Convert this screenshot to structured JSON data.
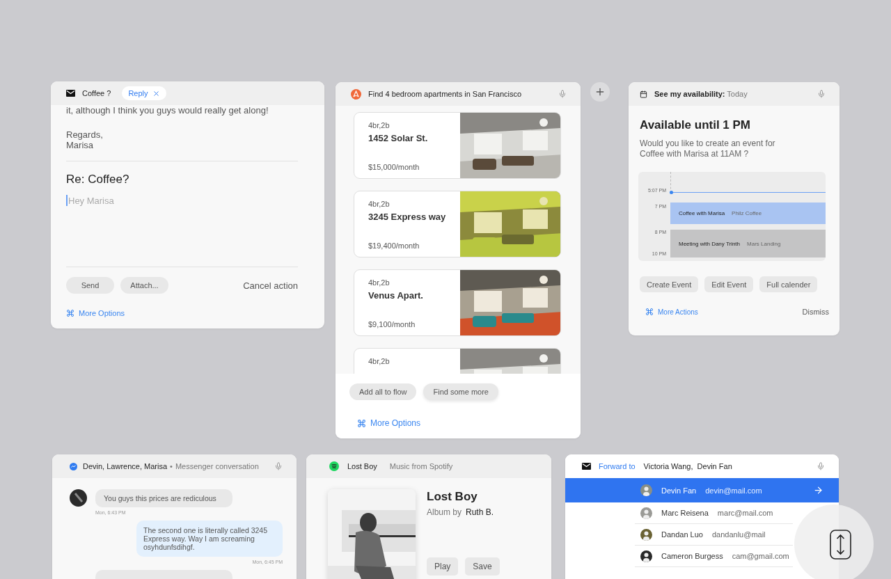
{
  "email_card": {
    "subject": "Coffee ?",
    "chip": {
      "label": "Reply"
    },
    "body_lines": [
      "it, although I think you guys would really get along!"
    ],
    "signature": [
      "Regards,",
      "Marisa"
    ],
    "reply_title": "Re: Coffee?",
    "reply_field": {
      "placeholder": "Hey Marisa"
    },
    "buttons": [
      "Send",
      "Attach..."
    ],
    "cancel": "Cancel action",
    "more": "More Options"
  },
  "apartments_card": {
    "query": "Find 4 bedroom apartments in San Francisco",
    "listings": [
      {
        "rooms": "4br,2b",
        "title": "1452 Solar St.",
        "price": "$15,000/month"
      },
      {
        "rooms": "4br,2b",
        "title": "3245 Express way",
        "price": "$19,400/month"
      },
      {
        "rooms": "4br,2b",
        "title": "Venus Apart.",
        "price": "$9,100/month"
      },
      {
        "rooms": "4br,2b"
      }
    ],
    "buttons": [
      "Add all to flow",
      "Find some more"
    ],
    "more": "More Options"
  },
  "calendar_card": {
    "query": "**See my availability:** Today",
    "heading": "Available until 1 PM",
    "question": "Would you like to create an event for Coffee with Marisa at 11AM ?",
    "schedule": {
      "now": "5:07 PM",
      "events": [
        {
          "time": "7 PM",
          "title": "Coffee with Marisa",
          "place": "Philz Coffee",
          "color": "#a9c4f2"
        },
        {
          "time": "8 PM",
          "end": "10 PM",
          "title": "Meeting with Dany Trinth",
          "place": "Mars Landing",
          "color": "#c4c4c5"
        }
      ]
    },
    "buttons": [
      "Create Event",
      "Edit Event",
      "Full calender"
    ],
    "more": "More Actions",
    "dismiss": "Dismiss"
  },
  "messenger_card": {
    "participants": "Devin, Lawrence, Marisa",
    "separator": "•",
    "source": "Messenger conversation",
    "messages": [
      {
        "mine": false,
        "text": "You guys this prices are rediculous",
        "time": "Mon, 6:43 PM"
      },
      {
        "mine": true,
        "text": "The second one is literally called 3245 Express way. Way I am screaming osyhdunfsdihgf.",
        "time": "Mon, 6:45 PM"
      },
      {
        "mine": false
      }
    ]
  },
  "music_card": {
    "track": "Lost Boy",
    "source": "Music from Spotify",
    "title": "Lost Boy",
    "album_label": "Album by",
    "artist": "Ruth B.",
    "buttons": [
      "Play",
      "Save"
    ]
  },
  "forward_card": {
    "label": "Forward to",
    "recipients": "Victoria Wang,  Devin Fan",
    "contacts": [
      {
        "name": "Devin Fan",
        "email": "devin@mail.com",
        "selected": true
      },
      {
        "name": "Marc Reisena",
        "email": "marc@mail.com",
        "selected": false
      },
      {
        "name": "Dandan Luo",
        "email": "dandanlu@mail",
        "selected": false
      },
      {
        "name": "Cameron Burgess",
        "email": "cam@gmail.com",
        "selected": false
      }
    ]
  }
}
